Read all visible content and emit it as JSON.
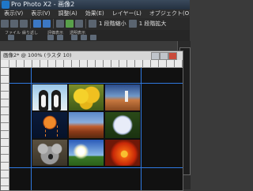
{
  "app": {
    "title": "Pro Photo X2 - 画像2"
  },
  "menu": [
    "表示(V)",
    "表示(V)",
    "調整(A)",
    "効果(E)",
    "レイヤー(L)",
    "オブジェクト(O)",
    "文字"
  ],
  "toolbar": {
    "zoom_out_label": "1 段階縮小",
    "zoom_in_label": "1 段階拡大"
  },
  "toolbar2": {
    "labels": [
      "ファイル",
      "繰り返し",
      "評価表示",
      "透明表示"
    ]
  },
  "document": {
    "title": "画像2* @ 100% (ラスタ 10)"
  },
  "photos": [
    {
      "name": "penguins"
    },
    {
      "name": "tulips"
    },
    {
      "name": "lighthouse"
    },
    {
      "name": "jellyfish"
    },
    {
      "name": "desert"
    },
    {
      "name": "hydrangea"
    },
    {
      "name": "koala"
    },
    {
      "name": "sky"
    },
    {
      "name": "flower"
    }
  ],
  "colors": {
    "guide": "#2f78e0",
    "canvas": "#111111"
  }
}
